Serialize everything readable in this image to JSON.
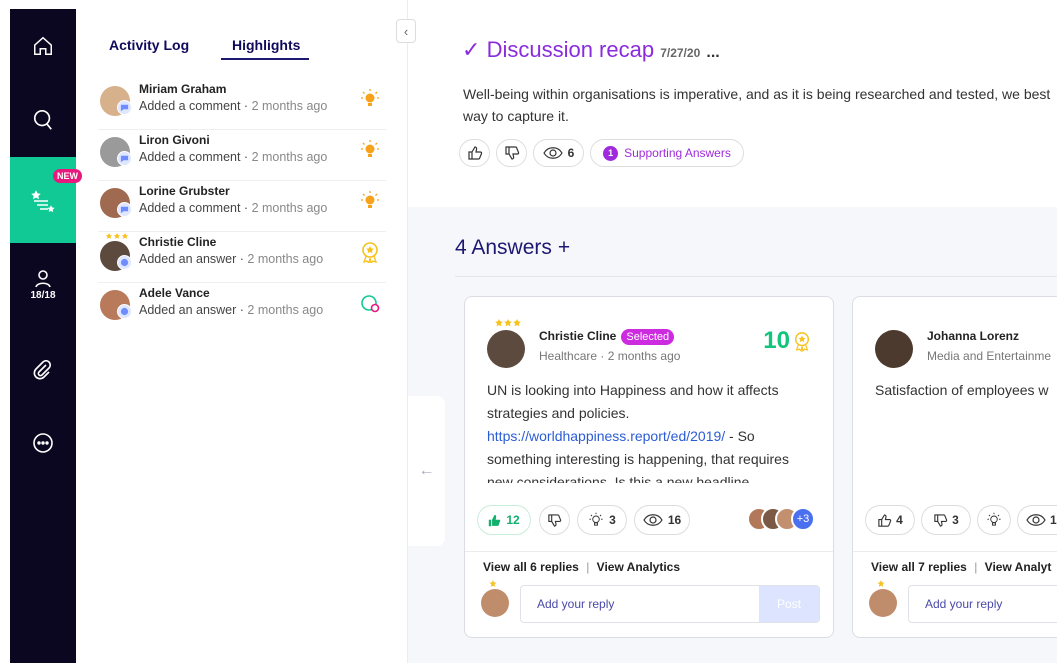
{
  "rail": {
    "items": [
      {
        "name": "home-icon"
      },
      {
        "name": "questions-icon"
      },
      {
        "name": "highlights-icon",
        "badge": "NEW"
      },
      {
        "name": "people-icon",
        "count": "18/18"
      },
      {
        "name": "attachments-icon"
      },
      {
        "name": "chat-icon"
      }
    ],
    "active_color": "#10c995"
  },
  "panel": {
    "tabs": [
      "Activity Log",
      "Highlights"
    ],
    "active_tab": "Highlights",
    "items": [
      {
        "name": "Miriam Graham",
        "action": "Added a comment",
        "ago": "2 months ago",
        "icon": "lightbulb-icon"
      },
      {
        "name": "Liron Givoni",
        "action": "Added a comment",
        "ago": "2 months ago",
        "icon": "lightbulb-icon"
      },
      {
        "name": "Lorine Grubster",
        "action": "Added a comment",
        "ago": "2 months ago",
        "icon": "lightbulb-icon"
      },
      {
        "name": "Christie Cline",
        "action": "Added an answer",
        "ago": "2 months ago",
        "icon": "award-icon"
      },
      {
        "name": "Adele Vance",
        "action": "Added an answer",
        "ago": "2 months ago",
        "icon": "answer-icon"
      }
    ]
  },
  "discussion": {
    "title": "Discussion recap",
    "date": "7/27/20",
    "more": "...",
    "text": "Well-being within organisations is imperative, and as it is being researched and tested, we best way to capture it.",
    "views": "6",
    "supporting_count": "1",
    "supporting_label": "Supporting Answers"
  },
  "answers": {
    "title": "4 Answers",
    "add": "+",
    "cards": [
      {
        "name": "Christie Cline",
        "selected_label": "Selected",
        "meta": "Healthcare · 2 months ago",
        "score": "10",
        "body_1": "UN is looking into Happiness and how it affects strategies and policies.",
        "link": "https://worldhappiness.report/ed/2019/",
        "body_2": " - So something interesting is happening, that requires new considerations. Is this a new headline",
        "likes": "12",
        "ideas": "3",
        "views": "16",
        "more_people": "+3",
        "view_replies": "View all 6 replies",
        "analytics": "View Analytics",
        "reply_placeholder": "Add your reply",
        "post": "Post"
      },
      {
        "name": "Johanna Lorenz",
        "meta": "Media and Entertainme",
        "body_1": "Satisfaction of employees w",
        "likes": "4",
        "dislikes": "3",
        "views": "1",
        "view_replies": "View all 7 replies",
        "analytics": "View Analyt",
        "reply_placeholder": "Add your reply"
      }
    ]
  }
}
